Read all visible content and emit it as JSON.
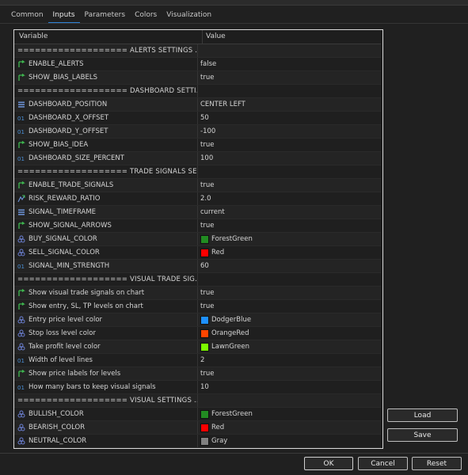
{
  "tabs": [
    {
      "label": "Common",
      "active": false
    },
    {
      "label": "Inputs",
      "active": true
    },
    {
      "label": "Parameters",
      "active": false
    },
    {
      "label": "Colors",
      "active": false
    },
    {
      "label": "Visualization",
      "active": false
    }
  ],
  "grid": {
    "header_variable": "Variable",
    "header_value": "Value"
  },
  "rows": [
    {
      "type": "sep",
      "name": "=================== ALERTS SETTINGS ..."
    },
    {
      "type": "bool",
      "name": "ENABLE_ALERTS",
      "value": "false"
    },
    {
      "type": "bool",
      "name": "SHOW_BIAS_LABELS",
      "value": "true"
    },
    {
      "type": "sep",
      "name": "=================== DASHBOARD SETTI..."
    },
    {
      "type": "enum",
      "name": "DASHBOARD_POSITION",
      "value": "CENTER LEFT"
    },
    {
      "type": "int",
      "name": "DASHBOARD_X_OFFSET",
      "value": "50"
    },
    {
      "type": "int",
      "name": "DASHBOARD_Y_OFFSET",
      "value": "-100"
    },
    {
      "type": "bool",
      "name": "SHOW_BIAS_IDEA",
      "value": "true"
    },
    {
      "type": "int",
      "name": "DASHBOARD_SIZE_PERCENT",
      "value": "100"
    },
    {
      "type": "sep",
      "name": "=================== TRADE SIGNALS SE..."
    },
    {
      "type": "bool",
      "name": "ENABLE_TRADE_SIGNALS",
      "value": "true"
    },
    {
      "type": "double",
      "name": "RISK_REWARD_RATIO",
      "value": "2.0"
    },
    {
      "type": "enum",
      "name": "SIGNAL_TIMEFRAME",
      "value": "current"
    },
    {
      "type": "bool",
      "name": "SHOW_SIGNAL_ARROWS",
      "value": "true"
    },
    {
      "type": "color",
      "name": "BUY_SIGNAL_COLOR",
      "value": "ForestGreen",
      "swatch": "#228b22"
    },
    {
      "type": "color",
      "name": "SELL_SIGNAL_COLOR",
      "value": "Red",
      "swatch": "#ff0000"
    },
    {
      "type": "int",
      "name": "SIGNAL_MIN_STRENGTH",
      "value": "60"
    },
    {
      "type": "sep",
      "name": "=================== VISUAL TRADE SIG..."
    },
    {
      "type": "bool",
      "name": "Show visual trade signals on chart",
      "value": "true"
    },
    {
      "type": "bool",
      "name": "Show entry, SL, TP levels on chart",
      "value": "true"
    },
    {
      "type": "color",
      "name": "Entry price level color",
      "value": "DodgerBlue",
      "swatch": "#1e90ff"
    },
    {
      "type": "color",
      "name": "Stop loss level color",
      "value": "OrangeRed",
      "swatch": "#ff4500"
    },
    {
      "type": "color",
      "name": "Take profit level color",
      "value": "LawnGreen",
      "swatch": "#7cfc00"
    },
    {
      "type": "int",
      "name": "Width of level lines",
      "value": "2"
    },
    {
      "type": "bool",
      "name": "Show price labels for levels",
      "value": "true"
    },
    {
      "type": "int",
      "name": "How many bars to keep visual signals",
      "value": "10"
    },
    {
      "type": "sep",
      "name": "=================== VISUAL SETTINGS ..."
    },
    {
      "type": "color",
      "name": "BULLISH_COLOR",
      "value": "ForestGreen",
      "swatch": "#228b22"
    },
    {
      "type": "color",
      "name": "BEARISH_COLOR",
      "value": "Red",
      "swatch": "#ff0000"
    },
    {
      "type": "color",
      "name": "NEUTRAL_COLOR",
      "value": "Gray",
      "swatch": "#808080"
    }
  ],
  "buttons": {
    "load": "Load",
    "save": "Save",
    "ok": "OK",
    "cancel": "Cancel",
    "reset": "Reset"
  },
  "colors": {
    "accent": "#2d83d6",
    "bool_icon": "#3fb950",
    "int_icon": "#4a8fd6",
    "enum_icon": "#6a8fd0",
    "color_icon": "#6b7fd0"
  }
}
